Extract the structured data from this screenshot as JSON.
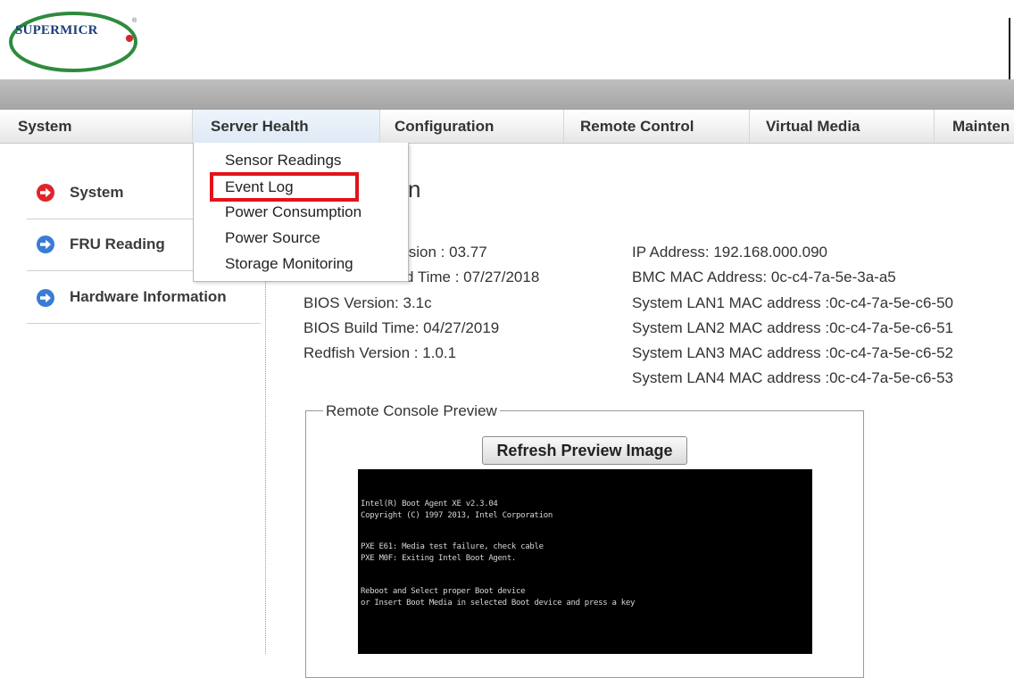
{
  "header": {
    "logo_text": "SUPERMICR",
    "logo_tm": "®"
  },
  "nav": {
    "items": [
      {
        "label": "System"
      },
      {
        "label": "Server Health"
      },
      {
        "label": "Configuration"
      },
      {
        "label": "Remote Control"
      },
      {
        "label": "Virtual Media"
      },
      {
        "label": "Mainten"
      }
    ],
    "active": "Server Health"
  },
  "dropdown": {
    "items": [
      {
        "label": "Sensor Readings"
      },
      {
        "label": "Event Log"
      },
      {
        "label": "Power Consumption"
      },
      {
        "label": "Power Source"
      },
      {
        "label": "Storage Monitoring"
      }
    ],
    "highlighted": "Event Log",
    "highlight_color": "#e2131a"
  },
  "sidebar": {
    "items": [
      {
        "label": "System",
        "icon": "arrow-right-circle-icon",
        "color": "#e0242b"
      },
      {
        "label": "FRU Reading",
        "icon": "arrow-right-circle-icon",
        "color": "#3a7bd5"
      },
      {
        "label": "Hardware Information",
        "icon": "arrow-right-circle-icon",
        "color": "#3a7bd5"
      }
    ]
  },
  "main": {
    "heading_tail": "n",
    "left_info": [
      "ision : 03.77",
      "d Time : 07/27/2018",
      "BIOS Version: 3.1c",
      "BIOS Build Time: 04/27/2019",
      "Redfish Version : 1.0.1"
    ],
    "right_info": [
      "IP Address:  192.168.000.090",
      "BMC MAC Address:  0c-c4-7a-5e-3a-a5",
      "System LAN1 MAC address :0c-c4-7a-5e-c6-50",
      "System LAN2 MAC address :0c-c4-7a-5e-c6-51",
      "System LAN3 MAC address :0c-c4-7a-5e-c6-52",
      "System LAN4 MAC address :0c-c4-7a-5e-c6-53"
    ]
  },
  "preview": {
    "legend": "Remote Console Preview",
    "refresh_label": "Refresh Preview Image",
    "console_lines": [
      "Intel(R) Boot Agent XE v2.3.04",
      "Copyright (C) 1997 2013, Intel Corporation",
      "",
      "PXE E61: Media test failure, check cable",
      "PXE M0F: Exiting Intel Boot Agent.",
      "",
      "Reboot and Select proper Boot device",
      "or Insert Boot Media in selected Boot device and press a key"
    ]
  }
}
